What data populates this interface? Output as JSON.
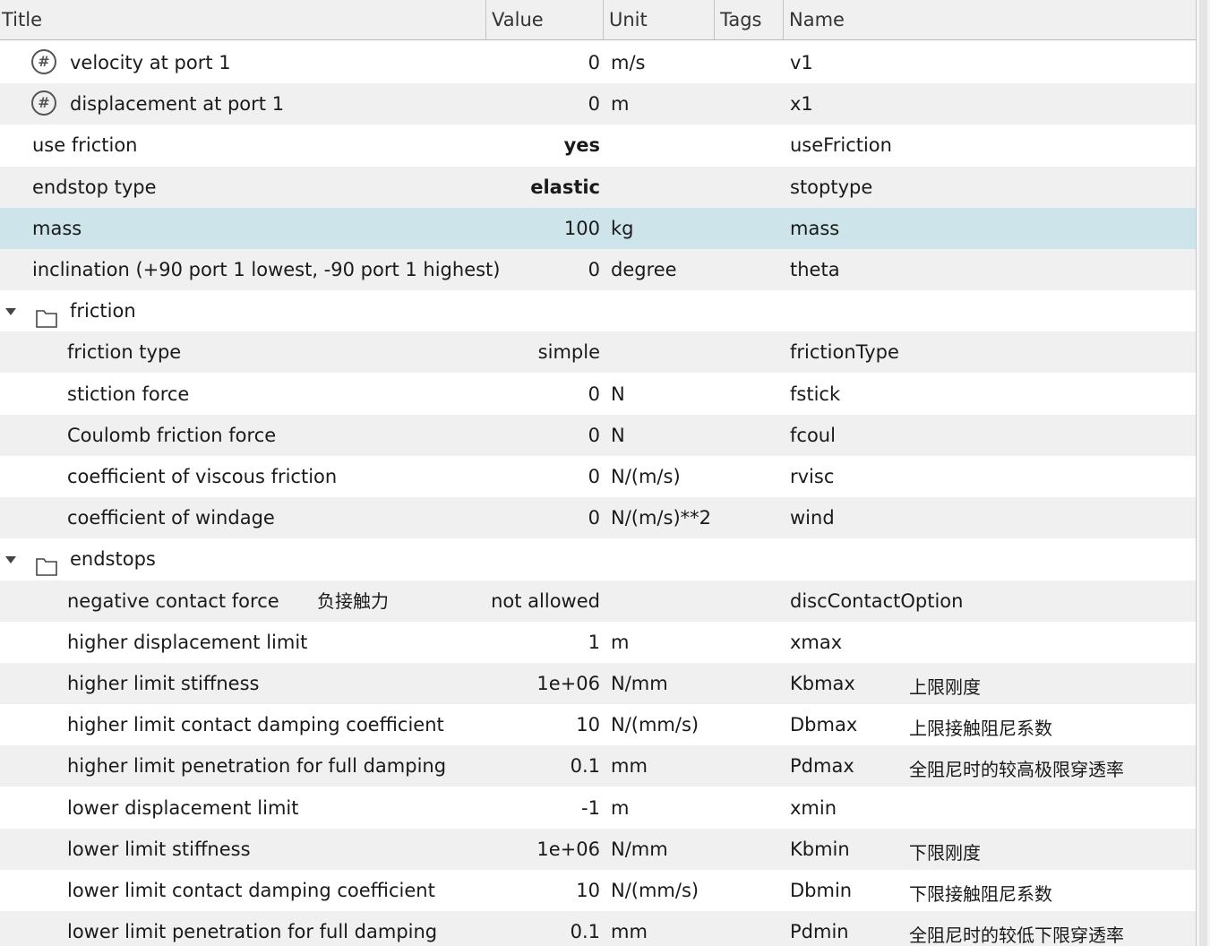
{
  "columns": {
    "title": "Title",
    "value": "Value",
    "unit": "Unit",
    "tags": "Tags",
    "name": "Name"
  },
  "rows": [
    {
      "title": "velocity at port 1",
      "value": "0",
      "unit": "m/s",
      "name": "v1",
      "icon": "hash-icon"
    },
    {
      "title": "displacement at port 1",
      "value": "0",
      "unit": "m",
      "name": "x1",
      "icon": "hash-icon"
    },
    {
      "title": "use friction",
      "value": "yes",
      "unit": "",
      "name": "useFriction"
    },
    {
      "title": "endstop type",
      "value": "elastic",
      "unit": "",
      "name": "stoptype"
    },
    {
      "title": "mass",
      "value": "100",
      "unit": "kg",
      "name": "mass"
    },
    {
      "title": "inclination (+90 port 1 lowest, -90 port 1 highest)",
      "value": "0",
      "unit": "degree",
      "name": "theta"
    },
    {
      "group": "friction"
    },
    {
      "title": "friction type",
      "value": "simple",
      "unit": "",
      "name": "frictionType"
    },
    {
      "title": "stiction force",
      "value": "0",
      "unit": "N",
      "name": "fstick"
    },
    {
      "title": "Coulomb friction force",
      "value": "0",
      "unit": "N",
      "name": "fcoul"
    },
    {
      "title": "coefficient of viscous friction",
      "value": "0",
      "unit": "N/(m/s)",
      "name": "rvisc"
    },
    {
      "title": "coefficient of windage",
      "value": "0",
      "unit": "N/(m/s)**2",
      "name": "wind"
    },
    {
      "group": "endstops"
    },
    {
      "title": "negative contact force",
      "annotation": "负接触力",
      "value": "not allowed",
      "unit": "",
      "name": "discContactOption"
    },
    {
      "title": "higher displacement limit",
      "value": "1",
      "unit": "m",
      "name": "xmax"
    },
    {
      "title": "higher limit stiffness",
      "value": "1e+06",
      "unit": "N/mm",
      "name": "Kbmax",
      "annotation": "上限刚度"
    },
    {
      "title": "higher limit contact damping coefficient",
      "value": "10",
      "unit": "N/(mm/s)",
      "name": "Dbmax",
      "annotation": "上限接触阻尼系数"
    },
    {
      "title": "higher limit penetration for full damping",
      "value": "0.1",
      "unit": "mm",
      "name": "Pdmax",
      "annotation": "全阻尼时的较高极限穿透率"
    },
    {
      "title": "lower displacement limit",
      "value": "-1",
      "unit": "m",
      "name": "xmin"
    },
    {
      "title": "lower limit stiffness",
      "value": "1e+06",
      "unit": "N/mm",
      "name": "Kbmin",
      "annotation": "下限刚度"
    },
    {
      "title": "lower limit contact damping coefficient",
      "value": "10",
      "unit": "N/(mm/s)",
      "name": "Dbmin",
      "annotation": "下限接触阻尼系数"
    },
    {
      "title": "lower limit penetration for full damping",
      "value": "0.1",
      "unit": "mm",
      "name": "Pdmin",
      "annotation": "全阻尼时的较低下限穿透率"
    }
  ],
  "selected_row_name": "mass",
  "colors": {
    "header_bg": "#f0f0f0",
    "alt_row_bg": "#f0f0f0",
    "selected_bg": "#cde4ea"
  }
}
